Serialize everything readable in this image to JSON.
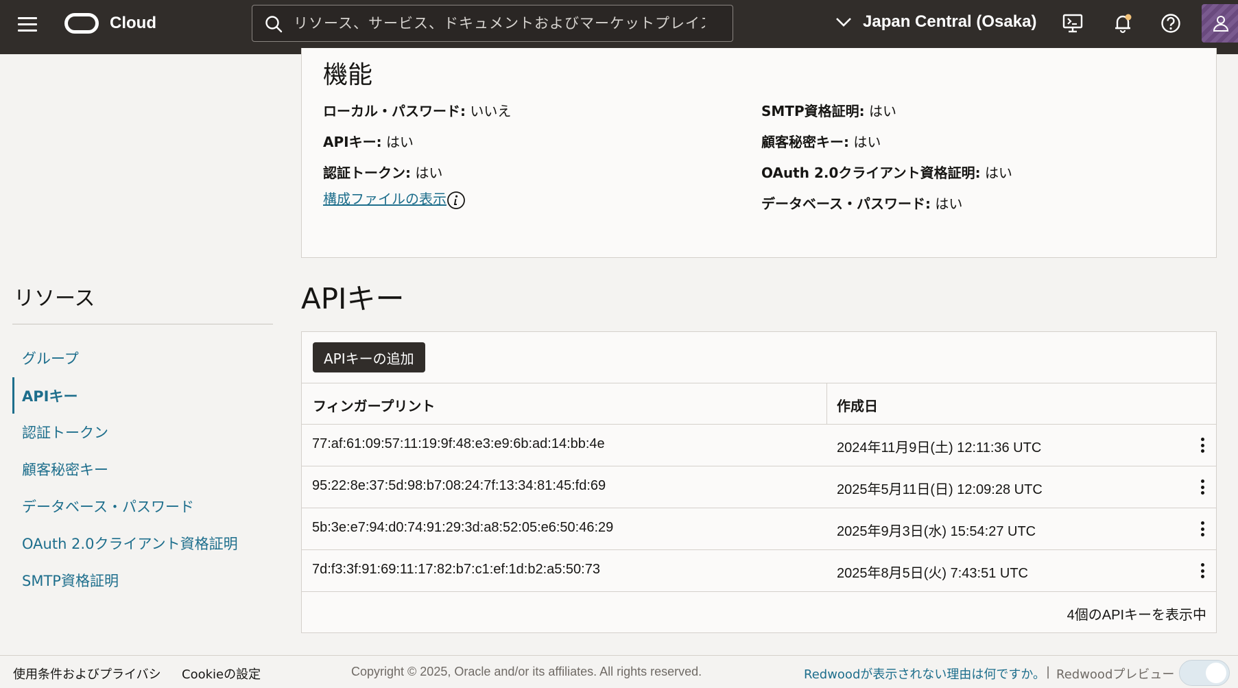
{
  "header": {
    "brand": "Cloud",
    "search_placeholder": "リソース、サービス、ドキュメントおよびマーケットプレイス",
    "region": "Japan Central (Osaka)"
  },
  "features": {
    "title": "機能",
    "left": [
      {
        "label": "ローカル・パスワード:",
        "value": "いいえ"
      },
      {
        "label": "APIキー:",
        "value": "はい"
      },
      {
        "label": "認証トークン:",
        "value": "はい"
      }
    ],
    "right": [
      {
        "label": "SMTP資格証明:",
        "value": "はい"
      },
      {
        "label": "顧客秘密キー:",
        "value": "はい"
      },
      {
        "label": "OAuth 2.0クライアント資格証明:",
        "value": "はい"
      },
      {
        "label": "データベース・パスワード:",
        "value": "はい"
      }
    ],
    "config_link": "構成ファイルの表示"
  },
  "sidebar": {
    "title": "リソース",
    "items": [
      {
        "label": "グループ"
      },
      {
        "label": "APIキー"
      },
      {
        "label": "認証トークン"
      },
      {
        "label": "顧客秘密キー"
      },
      {
        "label": "データベース・パスワード"
      },
      {
        "label": "OAuth 2.0クライアント資格証明"
      },
      {
        "label": "SMTP資格証明"
      }
    ]
  },
  "api_keys": {
    "title": "APIキー",
    "add_button": "APIキーの追加",
    "columns": [
      "フィンガープリント",
      "作成日"
    ],
    "rows": [
      {
        "fingerprint": "77:af:61:09:57:11:19:9f:48:e3:e9:6b:ad:14:bb:4e",
        "created": "2024年11月9日(土) 12:11:36 UTC"
      },
      {
        "fingerprint": "95:22:8e:37:5d:98:b7:08:24:7f:13:34:81:45:fd:69",
        "created": "2025年5月11日(日) 12:09:28 UTC"
      },
      {
        "fingerprint": "5b:3e:e7:94:d0:74:91:29:3d:a8:52:05:e6:50:46:29",
        "created": "2025年9月3日(水) 15:54:27 UTC"
      },
      {
        "fingerprint": "7d:f3:3f:91:69:11:17:82:b7:c1:ef:1d:b2:a5:50:73",
        "created": "2025年8月5日(火) 7:43:51 UTC"
      }
    ],
    "footer_count": "4個のAPIキーを表示中"
  },
  "footer": {
    "terms": "使用条件およびプライバシ",
    "cookie": "Cookieの設定",
    "copyright": "Copyright © 2025, Oracle and/or its affiliates. All rights reserved.",
    "redwood_why": "Redwoodが表示されない理由は何ですか。",
    "separator": "|",
    "redwood_preview": "Redwoodプレビュー"
  },
  "colors": {
    "header_bg": "#312d2a",
    "link": "#1d6e8c",
    "page_bg": "#f4f3f1"
  },
  "icons": [
    "menu-icon",
    "oracle-logo",
    "search-icon",
    "chevron-down-icon",
    "cloud-shell-icon",
    "bell-icon",
    "help-icon",
    "user-icon",
    "info-icon",
    "kebab-icon"
  ]
}
